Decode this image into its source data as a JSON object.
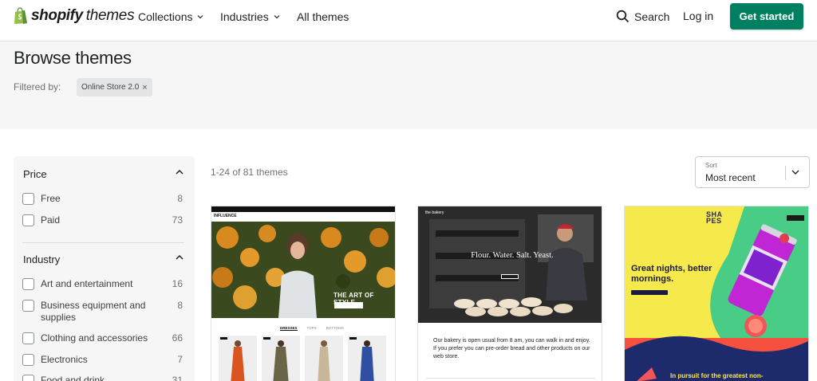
{
  "header": {
    "logo_word": "shopify",
    "logo_suffix": "themes",
    "nav": [
      {
        "label": "Collections"
      },
      {
        "label": "Industries"
      },
      {
        "label": "All themes"
      }
    ],
    "search_label": "Search",
    "login_label": "Log in",
    "cta_label": "Get started",
    "accent_color": "#008060"
  },
  "browse": {
    "title": "Browse themes",
    "filtered_label": "Filtered by:",
    "active_filter": "Online Store 2.0",
    "remove_icon": "×"
  },
  "filters": {
    "price": {
      "title": "Price",
      "options": [
        {
          "label": "Free",
          "count": "8"
        },
        {
          "label": "Paid",
          "count": "73"
        }
      ]
    },
    "industry": {
      "title": "Industry",
      "options": [
        {
          "label": "Art and entertainment",
          "count": "16"
        },
        {
          "label": "Business equipment and supplies",
          "count": "8"
        },
        {
          "label": "Clothing and accessories",
          "count": "66"
        },
        {
          "label": "Electronics",
          "count": "7"
        },
        {
          "label": "Food and drink",
          "count": "31"
        }
      ]
    }
  },
  "results": {
    "count_text": "1-24 of 81 themes",
    "sort_label": "Sort",
    "sort_value": "Most recent"
  },
  "themes": [
    {
      "logo": "INFLUENCE",
      "hero_title": "THE ART OF STYLE",
      "tabs": [
        "DRESSES",
        "TOPS",
        "BOTTOMS"
      ]
    },
    {
      "brand": "the bakery",
      "headline": "Flour. Water. Salt. Yeast.",
      "body": "Our bakery is open usual from 8 am, you can walk in and enjoy. If you prefer you can pre-order bread and other products on our web store."
    },
    {
      "logo_line1": "SHA",
      "logo_line2": "PES",
      "headline": "Great nights, better mornings.",
      "tagline": "In pursuit for the greatest non-"
    }
  ]
}
